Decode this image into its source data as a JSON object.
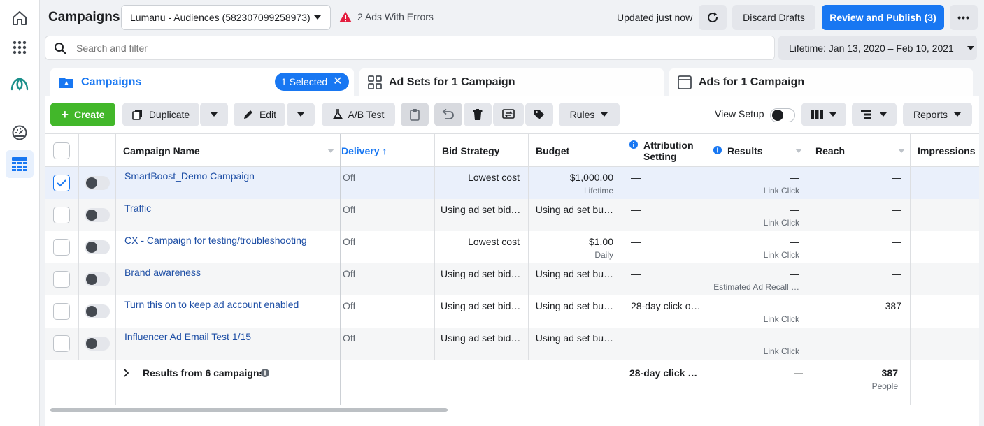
{
  "header": {
    "title": "Campaigns",
    "account": "Lumanu - Audiences (582307099258973)",
    "errors": "2 Ads With Errors",
    "updated": "Updated just now",
    "discard": "Discard Drafts",
    "publish": "Review and Publish (3)",
    "more": "•••"
  },
  "search": {
    "placeholder": "Search and filter"
  },
  "date_range": "Lifetime: Jan 13, 2020 – Feb 10, 2021",
  "tabs": {
    "campaigns": "Campaigns",
    "selected": "1 Selected",
    "adsets": "Ad Sets for 1 Campaign",
    "ads": "Ads for 1 Campaign"
  },
  "toolbar": {
    "create": "Create",
    "duplicate": "Duplicate",
    "edit": "Edit",
    "ab_test": "A/B Test",
    "rules": "Rules",
    "view_setup": "View Setup",
    "reports": "Reports"
  },
  "columns": {
    "name": "Campaign Name",
    "delivery": "Delivery",
    "bid": "Bid Strategy",
    "budget": "Budget",
    "attribution": "Attribution Setting",
    "results": "Results",
    "reach": "Reach",
    "impressions": "Impressions"
  },
  "rows": [
    {
      "name": "SmartBoost_Demo Campaign",
      "delivery": "Off",
      "bid": "Lowest cost",
      "budget": "$1,000.00",
      "budget_sub": "Lifetime",
      "attribution": "—",
      "results": "—",
      "results_sub": "Link Click",
      "reach": "—",
      "checked": true
    },
    {
      "name": "Traffic",
      "delivery": "Off",
      "bid": "Using ad set bid…",
      "budget": "Using ad set bu…",
      "budget_sub": "",
      "attribution": "—",
      "results": "—",
      "results_sub": "Link Click",
      "reach": "—",
      "checked": false
    },
    {
      "name": "CX - Campaign for testing/troubleshooting",
      "delivery": "Off",
      "bid": "Lowest cost",
      "budget": "$1.00",
      "budget_sub": "Daily",
      "attribution": "—",
      "results": "—",
      "results_sub": "Link Click",
      "reach": "—",
      "checked": false
    },
    {
      "name": "Brand awareness",
      "delivery": "Off",
      "bid": "Using ad set bid…",
      "budget": "Using ad set bu…",
      "budget_sub": "",
      "attribution": "—",
      "results": "—",
      "results_sub": "Estimated Ad Recall …",
      "reach": "—",
      "checked": false
    },
    {
      "name": "Turn this on to keep ad account enabled",
      "delivery": "Off",
      "bid": "Using ad set bid…",
      "budget": "Using ad set bu…",
      "budget_sub": "",
      "attribution": "28-day click o…",
      "results": "—",
      "results_sub": "Link Click",
      "reach": "387",
      "checked": false
    },
    {
      "name": "Influencer Ad Email Test 1/15",
      "delivery": "Off",
      "bid": "Using ad set bid…",
      "budget": "Using ad set bu…",
      "budget_sub": "",
      "attribution": "—",
      "results": "—",
      "results_sub": "Link Click",
      "reach": "—",
      "checked": false
    }
  ],
  "summary": {
    "label": "Results from 6 campaigns",
    "attribution": "28-day click o…",
    "results": "—",
    "reach": "387",
    "reach_sub": "People"
  },
  "colors": {
    "accent": "#1877f2",
    "create": "#42b72a",
    "link": "#1d4ea5",
    "error": "#e41e3f"
  }
}
